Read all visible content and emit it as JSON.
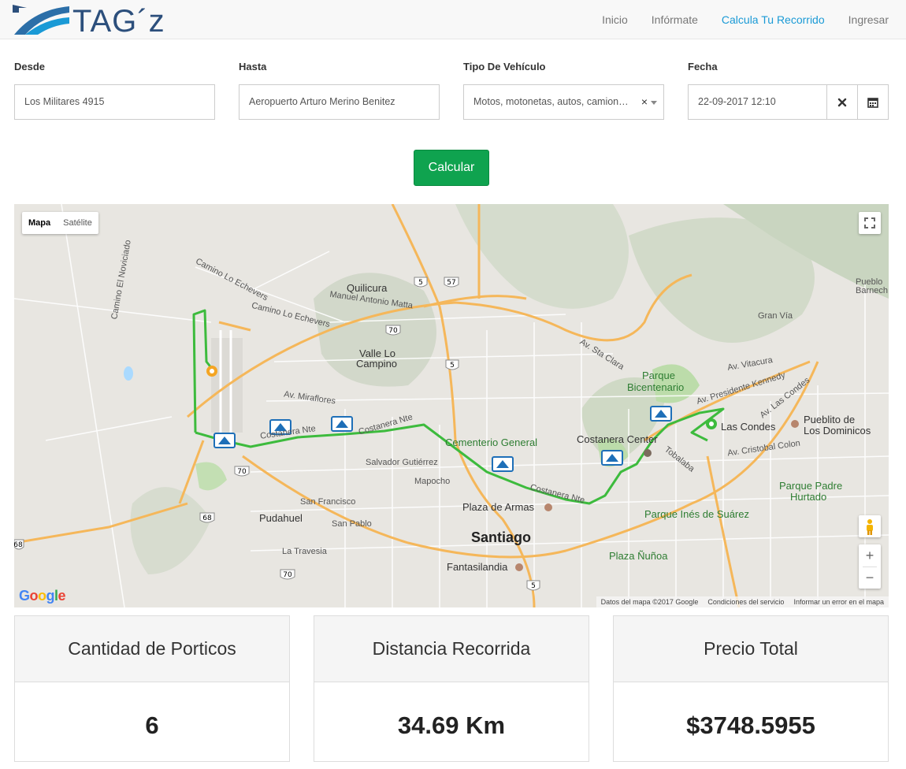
{
  "brand": {
    "logo_text": "TAG´z"
  },
  "nav": {
    "items": [
      {
        "label": "Inicio",
        "active": false
      },
      {
        "label": "Infórmate",
        "active": false
      },
      {
        "label": "Calcula Tu Recorrido",
        "active": true
      },
      {
        "label": "Ingresar",
        "active": false
      }
    ]
  },
  "form": {
    "desde": {
      "label": "Desde",
      "value": "Los Militares 4915"
    },
    "hasta": {
      "label": "Hasta",
      "value": "Aeropuerto Arturo Merino Benitez"
    },
    "vehiculo": {
      "label": "Tipo De Vehículo",
      "value": "Motos, motonetas, autos, camion…",
      "clear": "×"
    },
    "fecha": {
      "label": "Fecha",
      "value": "22-09-2017 12:10"
    },
    "submit_label": "Calcular"
  },
  "map": {
    "type_buttons": {
      "map": "Mapa",
      "satellite": "Satélite"
    },
    "attribution": {
      "data": "Datos del mapa ©2017 Google",
      "terms": "Condiciones del servicio",
      "report": "Informar un error en el mapa"
    },
    "google_logo": "Google",
    "labels": {
      "quilicura": "Quilicura",
      "manuel": "Manuel Antonio Matta",
      "valle1": "Valle Lo",
      "valle2": "Campino",
      "camino_lo": "Camino Lo Echevers",
      "cementerio": "Cementerio General",
      "costanera_center": "Costanera Center",
      "parque_bic1": "Parque",
      "parque_bic2": "Bicentenario",
      "las_condes": "Las Condes",
      "pueblito1": "Pueblito de",
      "pueblito2": "Los Dominicos",
      "parque_padre1": "Parque Padre",
      "parque_padre2": "Hurtado",
      "plaza_armas": "Plaza de Armas",
      "santiago": "Santiago",
      "pudahuel": "Pudahuel",
      "parque_ines": "Parque Inés de Suárez",
      "plaza_nunoa": "Plaza Ñuñoa",
      "fantasilandia": "Fantasilandia",
      "lo_barnech1": "Pueblo",
      "lo_barnech2": "Barnech",
      "costanera_norte": "Costanera Nte",
      "presidente_kennedy": "Av. Presidente Kennedy",
      "av_las_condes": "Av. Las Condes",
      "tobalaba": "Tobalaba",
      "vitacura": "Av. Vitacura",
      "san_francisco": "San Francisco",
      "san_pablo": "San Pablo",
      "mapocho": "Mapocho",
      "la_travesia": "La Travesia",
      "salvador": "Salvador Gutiérrez",
      "av_miraflores": "Av. Miraflores",
      "santa_clara": "Av. Sta Clara",
      "gran_via": "Gran Vía",
      "cristobal_colon": "Av. Cristobal Colon",
      "lo_novicio": "Camino El Noviciado",
      "camino_lo_echevers_2": "Camino Lo Echevers",
      "shield_5": "5",
      "shield_57": "57",
      "shield_70": "70",
      "shield_68": "68"
    }
  },
  "stats": [
    {
      "title": "Cantidad de Porticos",
      "value": "6"
    },
    {
      "title": "Distancia Recorrida",
      "value": "34.69 Km"
    },
    {
      "title": "Precio Total",
      "value": "$3748.5955"
    }
  ]
}
